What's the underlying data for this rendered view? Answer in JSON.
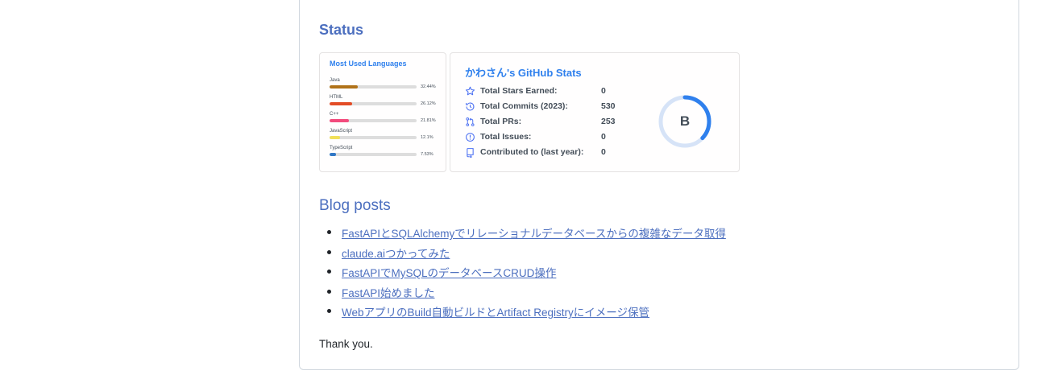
{
  "status": {
    "heading": "Status"
  },
  "languages_card": {
    "title": "Most Used Languages",
    "items": [
      {
        "name": "Java",
        "percent_label": "32.44%",
        "percent": 32.44,
        "color": "#b07219"
      },
      {
        "name": "HTML",
        "percent_label": "26.12%",
        "percent": 26.12,
        "color": "#e34c26"
      },
      {
        "name": "C++",
        "percent_label": "21.81%",
        "percent": 21.81,
        "color": "#f34b7d"
      },
      {
        "name": "JavaScript",
        "percent_label": "12.1%",
        "percent": 12.1,
        "color": "#f1e05a"
      },
      {
        "name": "TypeScript",
        "percent_label": "7.53%",
        "percent": 7.53,
        "color": "#3178c6"
      }
    ]
  },
  "stats_card": {
    "title": "かわさん's GitHub Stats",
    "rows": [
      {
        "icon": "star-icon",
        "label": "Total Stars Earned:",
        "value": "0"
      },
      {
        "icon": "history-icon",
        "label": "Total Commits (2023):",
        "value": "530"
      },
      {
        "icon": "pull-request-icon",
        "label": "Total PRs:",
        "value": "253"
      },
      {
        "icon": "issue-icon",
        "label": "Total Issues:",
        "value": "0"
      },
      {
        "icon": "repo-icon",
        "label": "Contributed to (last year):",
        "value": "0"
      }
    ],
    "rank": {
      "letter": "B",
      "progress": 0.37,
      "ring_color": "#2f80ed",
      "track_color": "#d6e3f7"
    }
  },
  "blog": {
    "heading": "Blog posts",
    "posts": [
      "FastAPIとSQLAlchemyでリレーショナルデータベースからの複雑なデータ取得",
      "claude.aiつかってみた",
      "FastAPIでMySQLのデータベースCRUD操作",
      "FastAPI始めました",
      "WebアプリのBuild自動ビルドとArtifact Registryにイメージ保管"
    ]
  },
  "footer": {
    "thanks": "Thank you."
  }
}
